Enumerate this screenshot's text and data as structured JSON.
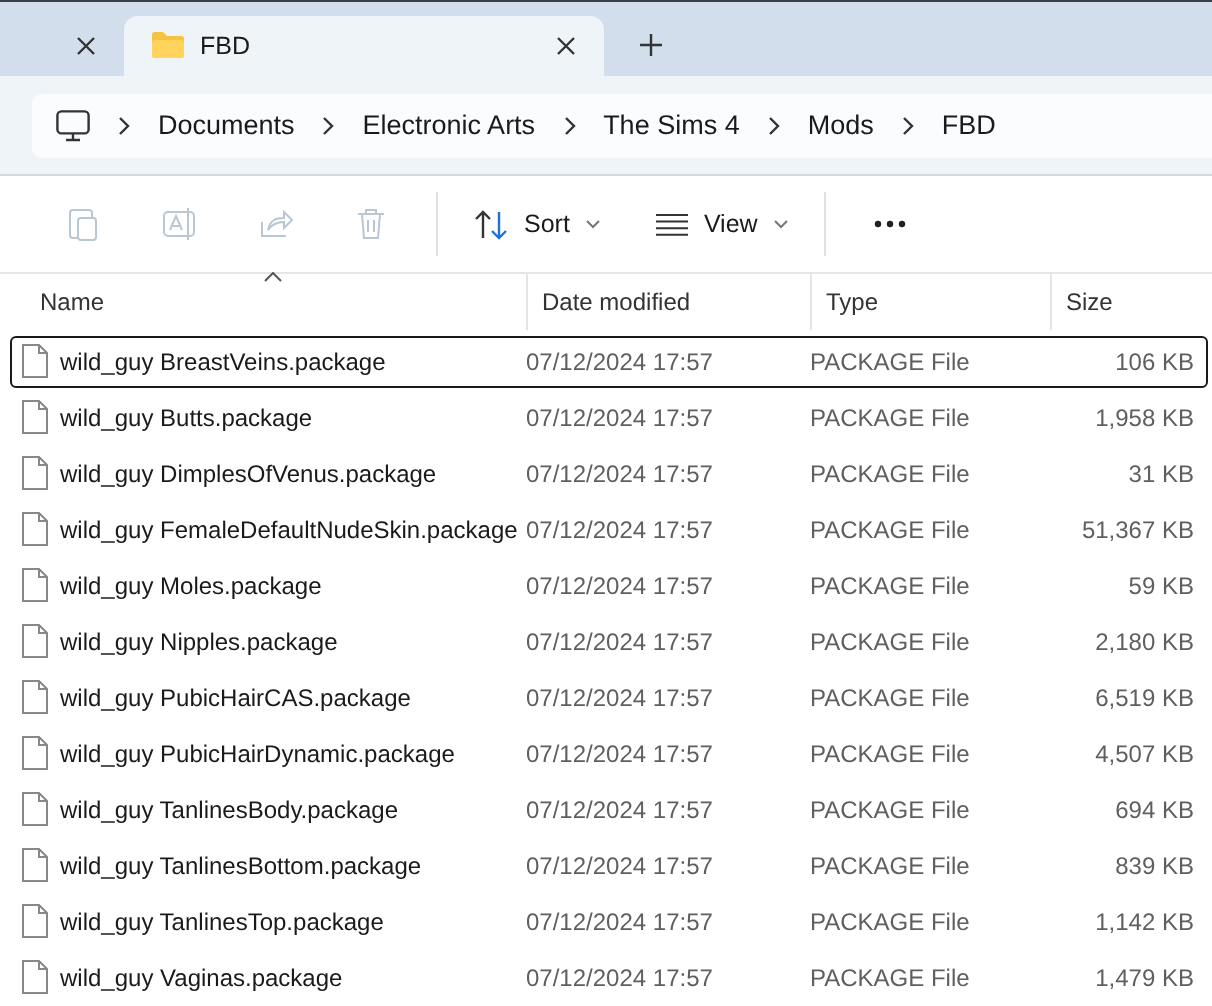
{
  "tabs": [
    {
      "selected": false
    },
    {
      "label": "FBD",
      "selected": true
    }
  ],
  "breadcrumb": [
    "Documents",
    "Electronic Arts",
    "The Sims 4",
    "Mods",
    "FBD"
  ],
  "toolbar": {
    "icon_buttons": [
      {
        "disabled": true
      },
      {
        "disabled": true
      },
      {
        "disabled": true
      },
      {
        "disabled": true
      }
    ],
    "sort": "Sort",
    "view": "View"
  },
  "table": {
    "columns": [
      {
        "label": "Name",
        "sorted": true
      },
      {
        "label": "Date modified",
        "sorted": false
      },
      {
        "label": "Type",
        "sorted": false
      },
      {
        "label": "Size",
        "sorted": false
      }
    ],
    "rows": [
      {
        "name": "wild_guy BreastVeins.package",
        "date": "07/12/2024 17:57",
        "type": "PACKAGE File",
        "size": "106 KB",
        "selected": true
      },
      {
        "name": "wild_guy Butts.package",
        "date": "07/12/2024 17:57",
        "type": "PACKAGE File",
        "size": "1,958 KB",
        "selected": false
      },
      {
        "name": "wild_guy DimplesOfVenus.package",
        "date": "07/12/2024 17:57",
        "type": "PACKAGE File",
        "size": "31 KB",
        "selected": false
      },
      {
        "name": "wild_guy FemaleDefaultNudeSkin.package",
        "date": "07/12/2024 17:57",
        "type": "PACKAGE File",
        "size": "51,367 KB",
        "selected": false
      },
      {
        "name": "wild_guy Moles.package",
        "date": "07/12/2024 17:57",
        "type": "PACKAGE File",
        "size": "59 KB",
        "selected": false
      },
      {
        "name": "wild_guy Nipples.package",
        "date": "07/12/2024 17:57",
        "type": "PACKAGE File",
        "size": "2,180 KB",
        "selected": false
      },
      {
        "name": "wild_guy PubicHairCAS.package",
        "date": "07/12/2024 17:57",
        "type": "PACKAGE File",
        "size": "6,519 KB",
        "selected": false
      },
      {
        "name": "wild_guy PubicHairDynamic.package",
        "date": "07/12/2024 17:57",
        "type": "PACKAGE File",
        "size": "4,507 KB",
        "selected": false
      },
      {
        "name": "wild_guy TanlinesBody.package",
        "date": "07/12/2024 17:57",
        "type": "PACKAGE File",
        "size": "694 KB",
        "selected": false
      },
      {
        "name": "wild_guy TanlinesBottom.package",
        "date": "07/12/2024 17:57",
        "type": "PACKAGE File",
        "size": "839 KB",
        "selected": false
      },
      {
        "name": "wild_guy TanlinesTop.package",
        "date": "07/12/2024 17:57",
        "type": "PACKAGE File",
        "size": "1,142 KB",
        "selected": false
      },
      {
        "name": "wild_guy Vaginas.package",
        "date": "07/12/2024 17:57",
        "type": "PACKAGE File",
        "size": "1,479 KB",
        "selected": false
      }
    ]
  }
}
